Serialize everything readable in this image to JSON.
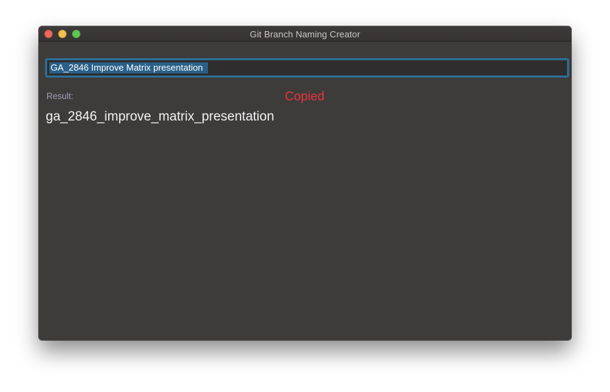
{
  "window": {
    "title": "Git Branch Naming Creator"
  },
  "input": {
    "value": "GA_2846 Improve Matrix presentation"
  },
  "result": {
    "label": "Result:",
    "value": "ga_2846_improve_matrix_presentation",
    "status": "Copied"
  },
  "colors": {
    "window_background": "#3e3b3b",
    "focus_ring": "#2c6f95",
    "selection": "#2a6088",
    "status_red": "#e8343b",
    "label_muted": "#9e9fb3"
  },
  "icons": [
    "close-button",
    "minimize-button",
    "zoom-button"
  ]
}
